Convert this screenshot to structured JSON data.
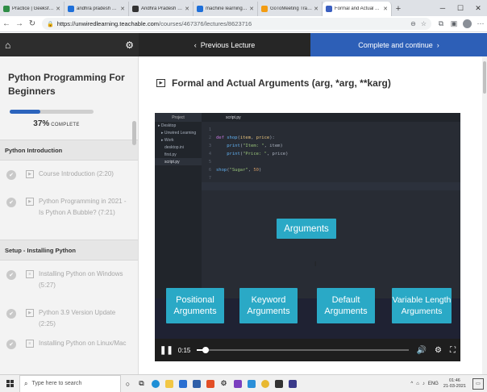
{
  "browser": {
    "tabs": [
      {
        "title": "Practice | GeeksforGeeks | A",
        "color": "#2f8d46"
      },
      {
        "title": "andhra pradesh state skill d",
        "color": "#1e6fd9"
      },
      {
        "title": "Andhra Pradesh State Skill",
        "color": "#333333"
      },
      {
        "title": "machine learning github uni",
        "color": "#1e6fd9"
      },
      {
        "title": "GoToMeeting Transcripts",
        "color": "#f39c12"
      },
      {
        "title": "Formal and Actual Argu",
        "color": "#3b5fc0"
      }
    ],
    "url_host": "https://unwiredlearning.teachable.com",
    "url_path": "/courses/467376/lectures/8623716"
  },
  "nav": {
    "prev_label": "Previous Lecture",
    "next_label": "Complete and continue"
  },
  "sidebar": {
    "course_title": "Python Programming For Beginners",
    "progress": {
      "percent": 37,
      "percent_text": "37%",
      "complete_text": "COMPLETE"
    },
    "sections": [
      {
        "title": "Python Introduction",
        "lectures": [
          {
            "title": "Course Introduction (2:20)",
            "kind": "video"
          },
          {
            "title": "Python Programming in 2021 - Is Python A Bubble? (7:21)",
            "kind": "video"
          }
        ]
      },
      {
        "title": "Setup - Installing Python",
        "lectures": [
          {
            "title": "Installing Python on Windows (5:27)",
            "kind": "text"
          },
          {
            "title": "Python 3.9 Version Update (2:25)",
            "kind": "video"
          },
          {
            "title": "Installing Python on Linux/Mac",
            "kind": "text"
          }
        ]
      }
    ]
  },
  "lecture": {
    "title": "Formal and Actual Arguments (arg, *arg, **karg)"
  },
  "video": {
    "ide": {
      "project_label": "Project",
      "tab_label": "script.py",
      "tree": [
        "Desktop",
        "Unwired Learning",
        "Work",
        "desktop.ini",
        "first.py",
        "script.py"
      ],
      "line_numbers": [
        "1",
        "2",
        "3",
        "4",
        "5",
        "6",
        "7"
      ]
    },
    "boxes": {
      "main": "Arguments",
      "positional": [
        "Positional",
        "Arguments"
      ],
      "keyword": [
        "Keyword",
        "Arguments"
      ],
      "default": [
        "Default",
        "Arguments"
      ],
      "variable": [
        "Variable Length",
        "Arguments"
      ]
    },
    "time": "0:15",
    "progress": 0.04
  },
  "taskbar": {
    "search_placeholder": "Type here to search",
    "lang": "ENG",
    "time": "01:46",
    "date": "21-03-2021"
  }
}
